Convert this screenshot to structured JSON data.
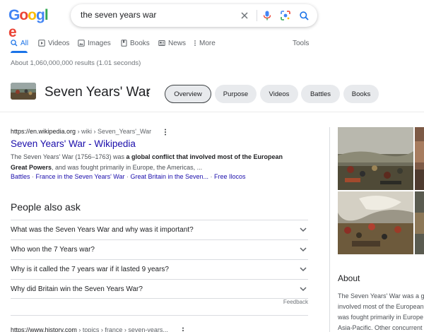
{
  "search": {
    "logo_letters": [
      "G",
      "o",
      "o",
      "g",
      "l",
      "e"
    ],
    "query": "the seven years war",
    "tools_label": "Tools"
  },
  "tabs": [
    {
      "label": "All",
      "icon": "search-icon",
      "active": true
    },
    {
      "label": "Videos",
      "icon": "video-icon",
      "active": false
    },
    {
      "label": "Images",
      "icon": "image-icon",
      "active": false
    },
    {
      "label": "Books",
      "icon": "book-icon",
      "active": false
    },
    {
      "label": "News",
      "icon": "news-icon",
      "active": false
    },
    {
      "label": "More",
      "icon": "more-vert-icon",
      "active": false
    }
  ],
  "results_count": "About 1,060,000,000 results (1.01 seconds)",
  "entity": {
    "title": "Seven Years' War",
    "chips": [
      "Overview",
      "Purpose",
      "Videos",
      "Battles",
      "Books"
    ],
    "selected_chip": "Overview"
  },
  "result1": {
    "url_host": "https://en.wikipedia.org",
    "url_path": " › wiki › Seven_Years'_War",
    "title": "Seven Years' War - Wikipedia",
    "snippet_a": "The Seven Years' War (1756–1763) was ",
    "snippet_b": "a global conflict that involved most of the European",
    "snippet_c": "Great Powers",
    "snippet_d": ", and was fought primarily in Europe, the Americas, ...",
    "sitelinks": [
      "Battles",
      "France in the Seven Years' War",
      "Great Britain in the Seven...",
      "Free Ilocos"
    ]
  },
  "paa": {
    "title": "People also ask",
    "questions": [
      "What was the Seven Years War and why was it important?",
      "Who won the 7 Years war?",
      "Why is it called the 7 years war if it lasted 9 years?",
      "Why did Britain win the Seven Years War?"
    ],
    "feedback": "Feedback"
  },
  "result2": {
    "url_host": "https://www.history.com",
    "url_path": " › topics › france › seven-years..."
  },
  "knowledge_panel": {
    "about": "About",
    "desc_lines": [
      "The Seven Years' War was a g",
      "involved most of the European",
      "was fought primarily in Europe",
      "Asia-Pacific. Other concurrent"
    ]
  },
  "colors": {
    "link": "#1a0dab",
    "accent": "#1a73e8",
    "chip_bg": "#e8eaed"
  }
}
